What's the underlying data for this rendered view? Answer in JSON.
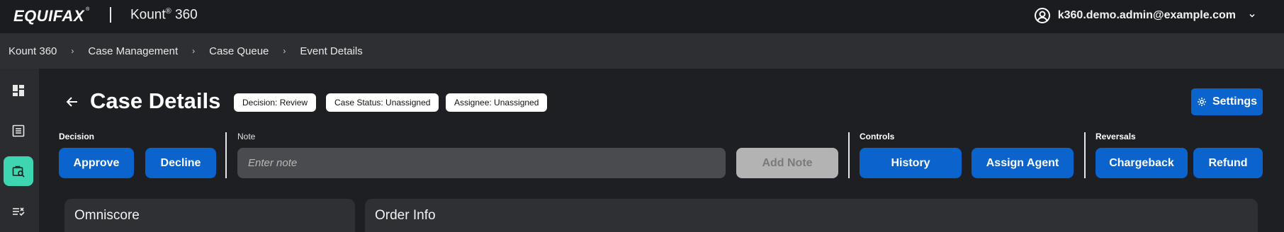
{
  "brand": {
    "logo_text": "EQUIFAX",
    "logo_mark": "®",
    "app_name": "Kount",
    "app_mark": "®",
    "app_suffix": " 360"
  },
  "user": {
    "email": "k360.demo.admin@example.com"
  },
  "breadcrumb": [
    "Kount 360",
    "Case Management",
    "Case Queue",
    "Event Details"
  ],
  "breadcrumb_separator": "›",
  "rail_items": [
    {
      "icon": "dashboard-icon",
      "active": false
    },
    {
      "icon": "list-icon",
      "active": false
    },
    {
      "icon": "case-search-icon",
      "active": true
    },
    {
      "icon": "rules-icon",
      "active": false
    }
  ],
  "page": {
    "title": "Case Details",
    "pills": [
      "Decision: Review",
      "Case Status: Unassigned",
      "Assignee: Unassigned"
    ],
    "settings_label": "Settings"
  },
  "actions": {
    "decision": {
      "label": "Decision",
      "approve": "Approve",
      "decline": "Decline"
    },
    "note": {
      "label": "Note",
      "placeholder": "Enter note",
      "value": "",
      "add_label": "Add Note"
    },
    "controls": {
      "label": "Controls",
      "history": "History",
      "assign": "Assign Agent"
    },
    "reversals": {
      "label": "Reversals",
      "chargeback": "Chargeback",
      "refund": "Refund"
    }
  },
  "cards": [
    "Omniscore",
    "Order Info"
  ],
  "colors": {
    "accent": "#0b63ce",
    "active_rail": "#3ed6b0",
    "background": "#1e1f22",
    "topbar": "#1b1c1f",
    "crumbbar": "#2d2f33"
  }
}
